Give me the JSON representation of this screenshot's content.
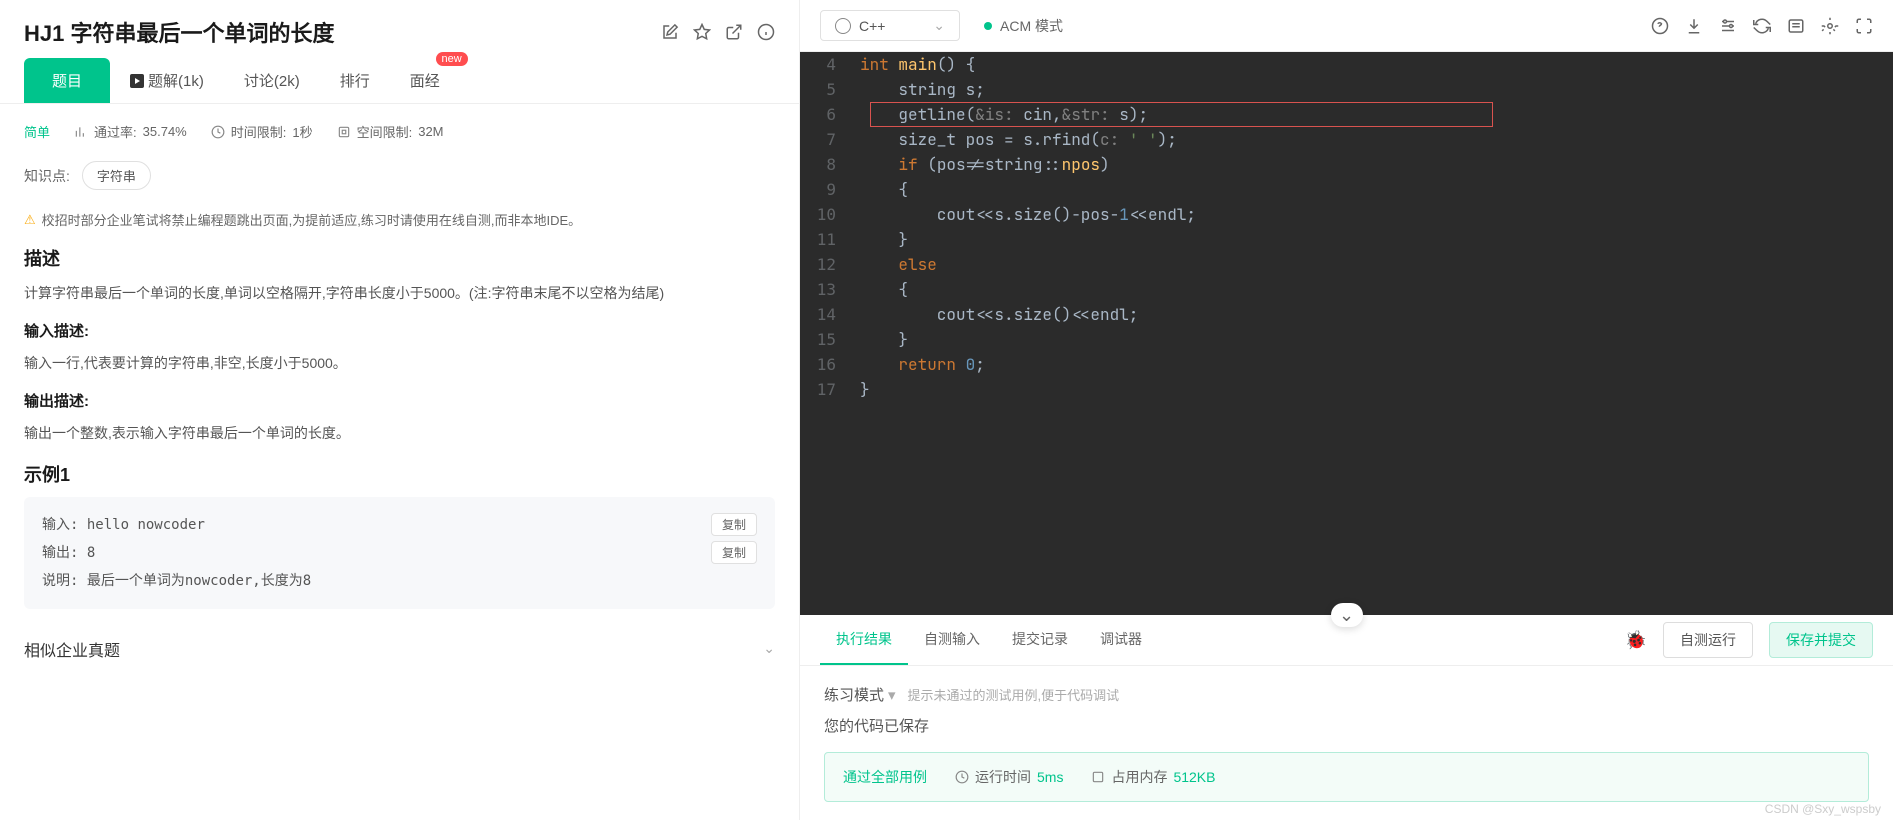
{
  "problem": {
    "title": "HJ1 字符串最后一个单词的长度",
    "tabs": {
      "problem": "题目",
      "solution": "题解(1k)",
      "discuss": "讨论(2k)",
      "rank": "排行",
      "interview": "面经",
      "new_badge": "new"
    },
    "meta": {
      "difficulty": "简单",
      "pass_rate_label": "通过率:",
      "pass_rate": "35.74%",
      "time_limit_label": "时间限制:",
      "time_limit": "1秒",
      "space_limit_label": "空间限制:",
      "space_limit": "32M"
    },
    "knowledge_label": "知识点:",
    "knowledge_tag": "字符串",
    "warning": "校招时部分企业笔试将禁止编程题跳出页面,为提前适应,练习时请使用在线自测,而非本地IDE。",
    "desc_header": "描述",
    "desc_body": "计算字符串最后一个单词的长度,单词以空格隔开,字符串长度小于5000。(注:字符串末尾不以空格为结尾)",
    "input_header": "输入描述:",
    "input_body": "输入一行,代表要计算的字符串,非空,长度小于5000。",
    "output_header": "输出描述:",
    "output_body": "输出一个整数,表示输入字符串最后一个单词的长度。",
    "example_header": "示例1",
    "example": {
      "input_label": "输入:",
      "input_value": "hello nowcoder",
      "output_label": "输出:",
      "output_value": "8",
      "explain_label": "说明:",
      "explain_value": "最后一个单词为nowcoder,长度为8",
      "copy_btn": "复制"
    },
    "similar_header": "相似企业真题"
  },
  "editor": {
    "language": "C++",
    "mode": "ACM 模式",
    "code_lines": [
      {
        "num": 4,
        "tokens": [
          {
            "t": "int ",
            "c": "kw"
          },
          {
            "t": "main",
            "c": "fn"
          },
          {
            "t": "() {",
            "c": "white"
          }
        ]
      },
      {
        "num": 5,
        "tokens": [
          {
            "t": "    string s;",
            "c": "white"
          }
        ]
      },
      {
        "num": 6,
        "tokens": [
          {
            "t": "    ",
            "c": "white"
          },
          {
            "t": "getline",
            "c": "white"
          },
          {
            "t": "(",
            "c": "white"
          },
          {
            "t": "&is: ",
            "c": "param"
          },
          {
            "t": "cin,",
            "c": "white"
          },
          {
            "t": "&str: ",
            "c": "param"
          },
          {
            "t": "s);",
            "c": "white"
          }
        ],
        "highlight": true
      },
      {
        "num": 7,
        "tokens": [
          {
            "t": "    size_t pos = s.rfind(",
            "c": "white"
          },
          {
            "t": "c: ",
            "c": "param"
          },
          {
            "t": "' '",
            "c": "str"
          },
          {
            "t": ");",
            "c": "white"
          }
        ]
      },
      {
        "num": 8,
        "tokens": [
          {
            "t": "    ",
            "c": "white"
          },
          {
            "t": "if ",
            "c": "kw"
          },
          {
            "t": "(pos!=string::",
            "c": "white"
          },
          {
            "t": "npos",
            "c": "fn"
          },
          {
            "t": ")",
            "c": "white"
          }
        ]
      },
      {
        "num": 9,
        "tokens": [
          {
            "t": "    {",
            "c": "white"
          }
        ]
      },
      {
        "num": 10,
        "tokens": [
          {
            "t": "        cout<<s.size()-pos-",
            "c": "white"
          },
          {
            "t": "1",
            "c": "num"
          },
          {
            "t": "<<endl;",
            "c": "white"
          }
        ]
      },
      {
        "num": 11,
        "tokens": [
          {
            "t": "    }",
            "c": "white"
          }
        ]
      },
      {
        "num": 12,
        "tokens": [
          {
            "t": "    ",
            "c": "white"
          },
          {
            "t": "else",
            "c": "kw"
          }
        ]
      },
      {
        "num": 13,
        "tokens": [
          {
            "t": "    {",
            "c": "white"
          }
        ]
      },
      {
        "num": 14,
        "tokens": [
          {
            "t": "        cout<<s.size()<<endl;",
            "c": "white"
          }
        ]
      },
      {
        "num": 15,
        "tokens": [
          {
            "t": "    }",
            "c": "white"
          }
        ]
      },
      {
        "num": 16,
        "tokens": [
          {
            "t": "    ",
            "c": "white"
          },
          {
            "t": "return ",
            "c": "kw"
          },
          {
            "t": "0",
            "c": "num"
          },
          {
            "t": ";",
            "c": "white"
          }
        ]
      },
      {
        "num": 17,
        "tokens": [
          {
            "t": "}",
            "c": "white"
          }
        ]
      }
    ]
  },
  "result": {
    "tabs": {
      "exec": "执行结果",
      "self_test": "自测输入",
      "submit": "提交记录",
      "debug": "调试器"
    },
    "btn_self_run": "自测运行",
    "btn_save_submit": "保存并提交",
    "practice_mode": "练习模式",
    "practice_hint": "提示未通过的测试用例,便于代码调试",
    "save_msg": "您的代码已保存",
    "pass_text": "通过全部用例",
    "time_label": "运行时间",
    "time_value": "5ms",
    "mem_label": "占用内存",
    "mem_value": "512KB"
  },
  "watermark": "CSDN @Sxy_wspsby"
}
